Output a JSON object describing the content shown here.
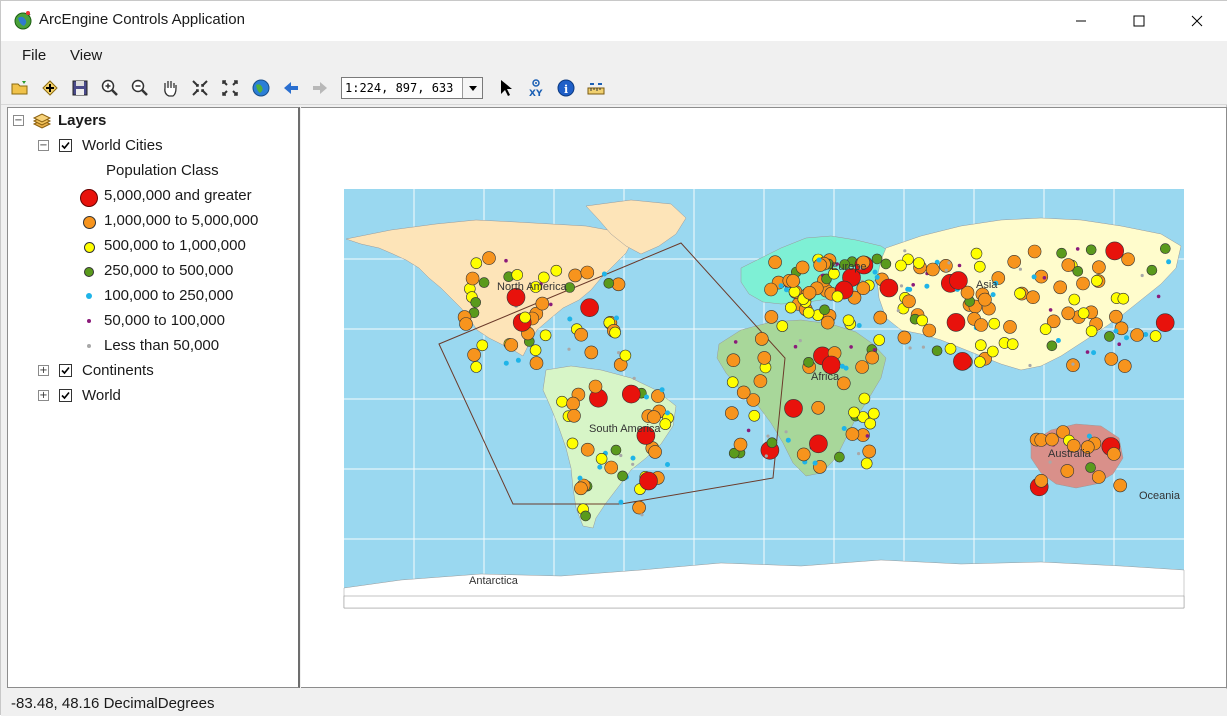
{
  "window": {
    "title": "ArcEngine Controls Application"
  },
  "menu": {
    "items": [
      "File",
      "View"
    ]
  },
  "toolbar": {
    "tools": [
      "open-icon",
      "add-data-icon",
      "save-icon",
      "zoom-in-icon",
      "zoom-out-icon",
      "pan-icon",
      "fixed-zoom-in-icon",
      "fixed-zoom-out-icon",
      "full-extent-icon",
      "back-icon",
      "forward-icon"
    ],
    "scale_value": "1:224, 897, 633",
    "tools_right": [
      "select-icon",
      "go-to-xy-icon",
      "identify-icon",
      "measure-icon"
    ]
  },
  "toc": {
    "root_label": "Layers",
    "layers": [
      {
        "label": "World Cities",
        "checked": true,
        "expanded": true,
        "legend_heading": "Population Class",
        "classes": [
          {
            "label": "5,000,000 and greater",
            "color": "#e8120c",
            "symbol": "large-red-circle"
          },
          {
            "label": "1,000,000 to 5,000,000",
            "color": "#f7941d",
            "symbol": "orange-circle"
          },
          {
            "label": "500,000 to 1,000,000",
            "color": "#ffff00",
            "symbol": "yellow-circle"
          },
          {
            "label": "250,000 to 500,000",
            "color": "#5a9a1c",
            "symbol": "green-circle"
          },
          {
            "label": "100,000 to 250,000",
            "color": "#1fb4e8",
            "symbol": "cyan-dot"
          },
          {
            "label": "50,000 to 100,000",
            "color": "#8b1a7a",
            "symbol": "purple-dot"
          },
          {
            "label": "Less than 50,000",
            "color": "#a8a8a8",
            "symbol": "gray-dot"
          }
        ]
      },
      {
        "label": "Continents",
        "checked": true,
        "expanded": false
      },
      {
        "label": "World",
        "checked": true,
        "expanded": false
      }
    ]
  },
  "map": {
    "ocean_color": "#9ad8f0",
    "labels": [
      "North America",
      "Europe",
      "Asia",
      "Africa",
      "South America",
      "Australia",
      "Oceania",
      "Antarctica"
    ]
  },
  "status": {
    "coordinates": "-83.48, 48.16  DecimalDegrees"
  }
}
